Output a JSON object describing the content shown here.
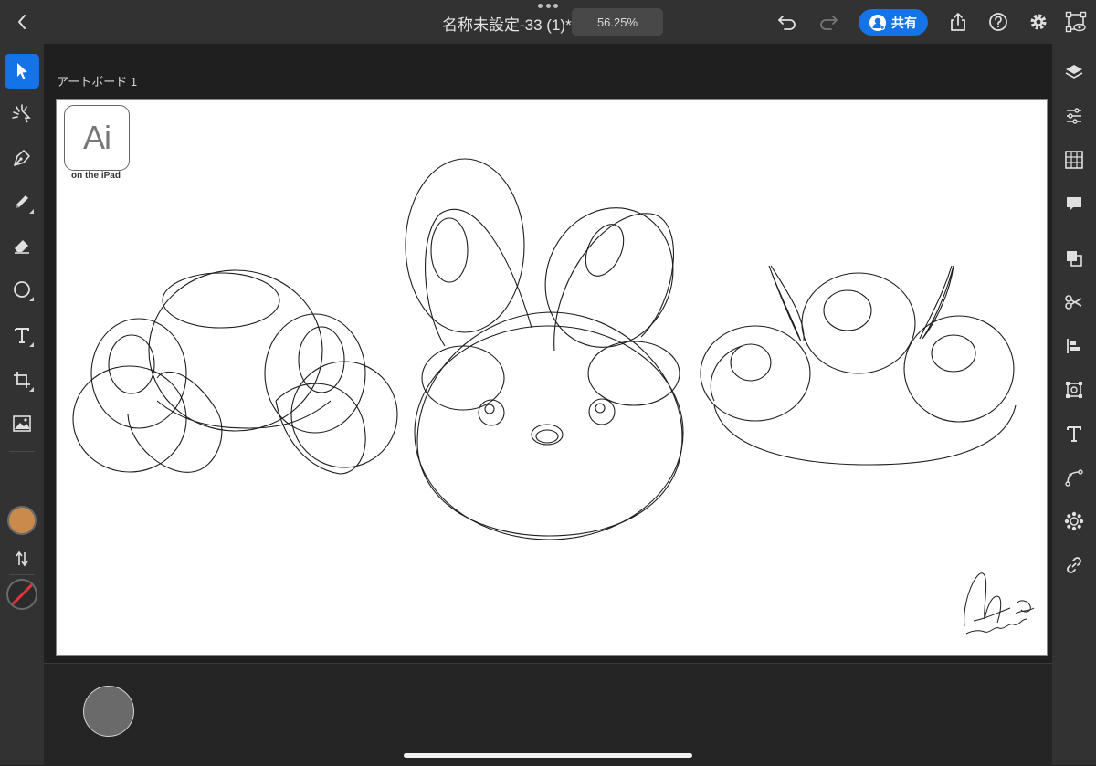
{
  "header": {
    "title": "名称未設定-33 (1)*",
    "zoom": "56.25%",
    "share_label": "共有"
  },
  "artboard": {
    "label": "アートボード 1",
    "logo_text": "Ai",
    "logo_sub": "on the iPad"
  },
  "left_tools": [
    "select-icon",
    "direct-select-icon",
    "pen-icon",
    "pencil-icon",
    "eraser-icon",
    "ellipse-icon",
    "type-icon",
    "transform-icon",
    "image-icon"
  ],
  "right_tools": [
    "layers-icon",
    "properties-icon",
    "libraries-icon",
    "comments-icon",
    "pathfinder-icon",
    "scissors-icon",
    "align-icon",
    "crop-icon",
    "type-panel-icon",
    "path-icon",
    "repeat-icon",
    "link-icon"
  ],
  "colors": {
    "accent": "#1473e6",
    "fill_color": "#c98a4b",
    "stroke_none": "#e23434"
  }
}
